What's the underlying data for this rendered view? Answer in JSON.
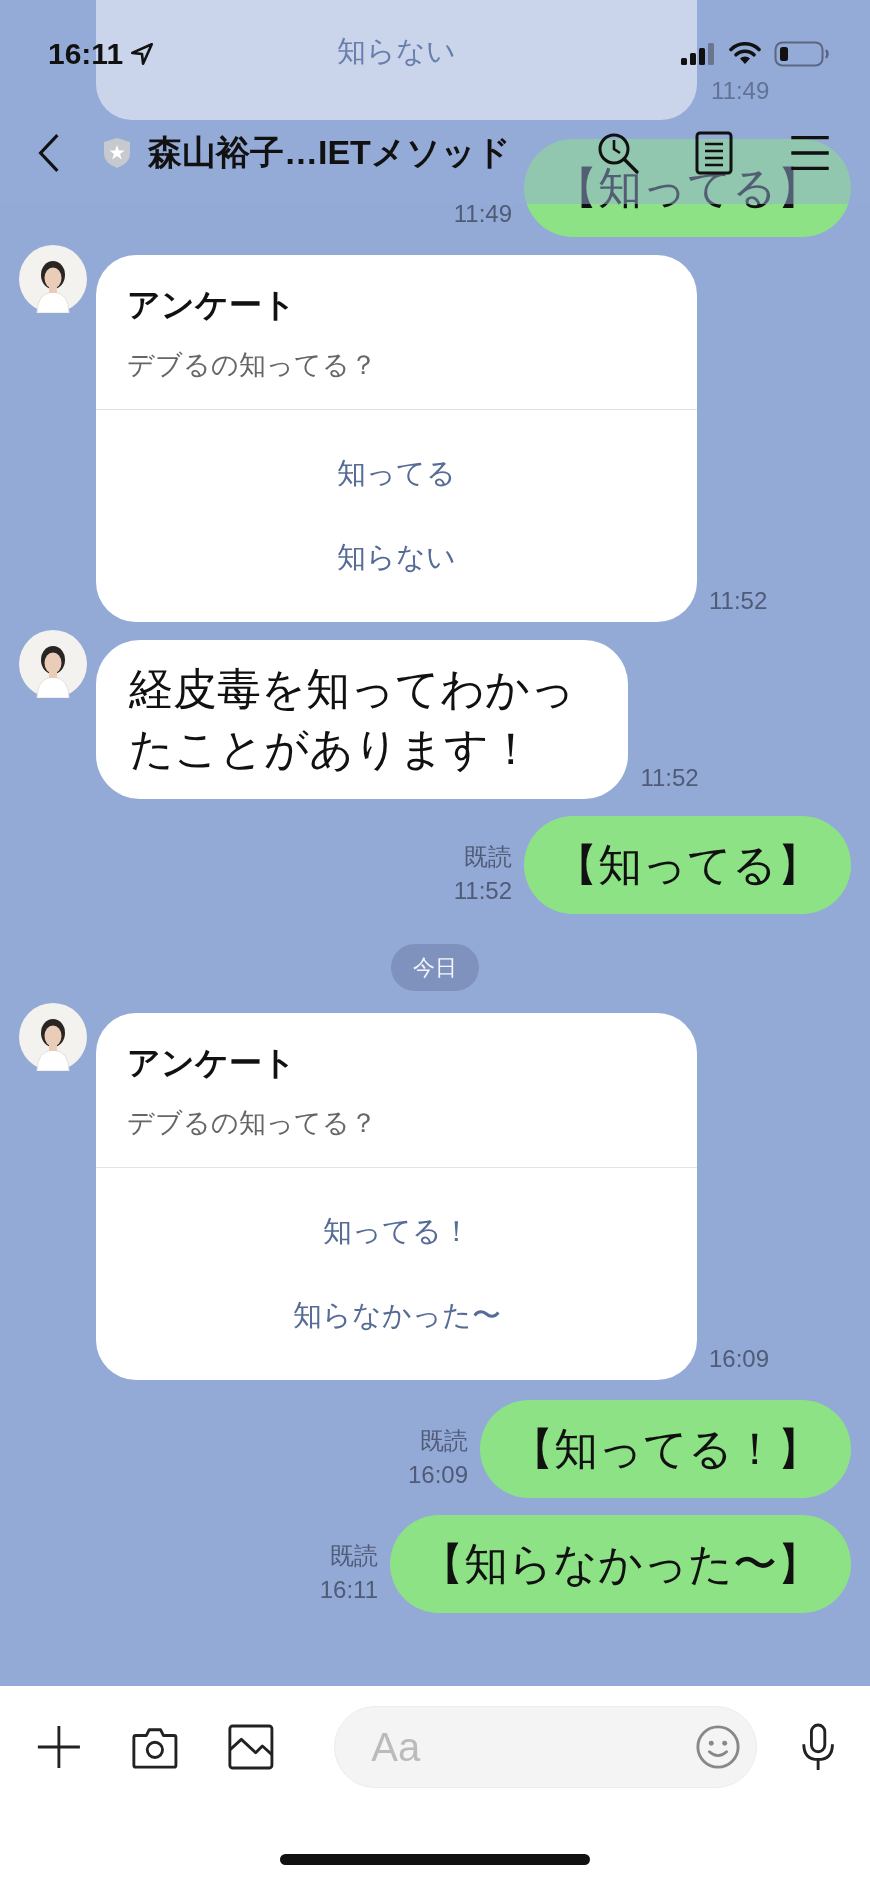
{
  "status_bar": {
    "time": "16:11"
  },
  "header": {
    "title": "森山裕子…IETメソッド"
  },
  "messages": [
    {
      "kind": "survey_fragment",
      "option": "知らない",
      "time": "11:49"
    },
    {
      "kind": "outgoing",
      "time": "11:49",
      "text": "【知ってる】"
    },
    {
      "kind": "survey",
      "title": "アンケート",
      "question": "デブるの知ってる？",
      "options": [
        "知ってる",
        "知らない"
      ],
      "time": "11:52"
    },
    {
      "kind": "incoming",
      "text": "経皮毒を知ってわかったことがあります！",
      "time": "11:52"
    },
    {
      "kind": "outgoing",
      "read": "既読",
      "time": "11:52",
      "text": "【知ってる】"
    },
    {
      "kind": "date",
      "text": "今日"
    },
    {
      "kind": "survey",
      "title": "アンケート",
      "question": "デブるの知ってる？",
      "options": [
        "知ってる！",
        "知らなかった〜"
      ],
      "time": "16:09"
    },
    {
      "kind": "outgoing",
      "read": "既読",
      "time": "16:09",
      "text": "【知ってる！】"
    },
    {
      "kind": "outgoing",
      "read": "既読",
      "time": "16:11",
      "text": "【知らなかった〜】"
    }
  ],
  "composer": {
    "placeholder": "Aa"
  }
}
